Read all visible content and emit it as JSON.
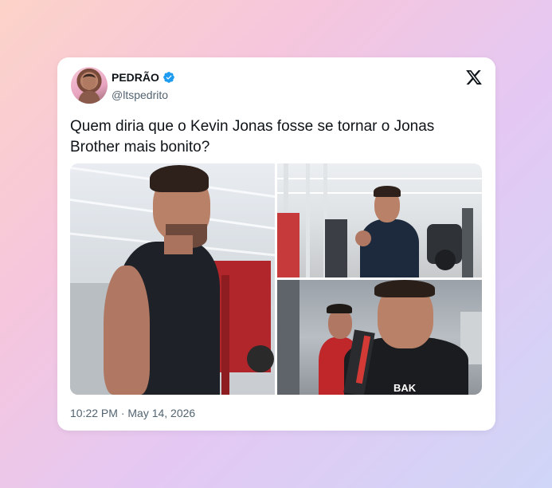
{
  "tweet": {
    "author_name": "PEDRÃO",
    "author_handle": "@ltspedrito",
    "text": "Quem diria que o Kevin Jonas fosse se tornar o Jonas Brother mais bonito?",
    "timestamp": "10:22 PM · May 14, 2026"
  },
  "media": {
    "shirt_text": "BAK"
  },
  "colors": {
    "verified": "#1d9bf0",
    "text_primary": "#0f1419",
    "text_secondary": "#536471"
  },
  "icons": [
    "verified-badge-icon",
    "x-logo-icon"
  ]
}
